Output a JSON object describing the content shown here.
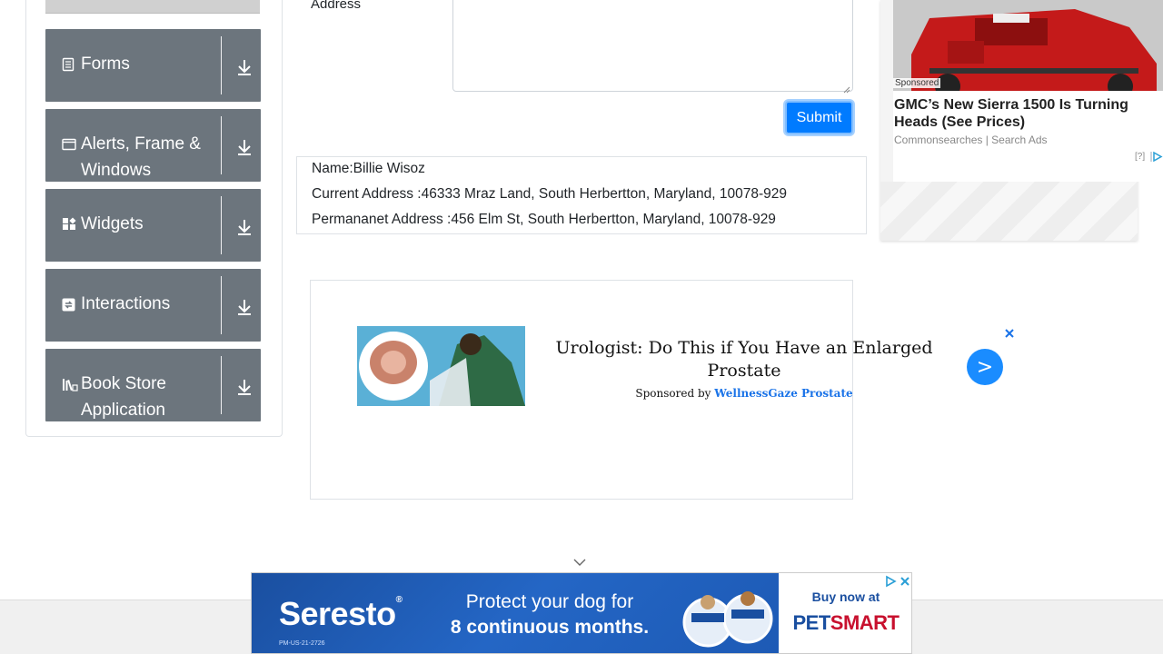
{
  "sidebar": {
    "groups": [
      {
        "label": "Forms",
        "icon": "document-icon"
      },
      {
        "label": "Alerts, Frame & Windows",
        "icon": "window-icon"
      },
      {
        "label": "Widgets",
        "icon": "widgets-icon"
      },
      {
        "label": "Interactions",
        "icon": "interactions-icon"
      },
      {
        "label": "Book Store Application",
        "icon": "books-icon"
      }
    ]
  },
  "form": {
    "address_label": "Address",
    "submit_label": "Submit"
  },
  "output": {
    "name": "Name:Billie Wisoz",
    "current_address": "Current Address :46333 Mraz Land, South Herbertton, Maryland, 10078-929",
    "permanent_address": "Permananet Address :456 Elm St, South Herbertton, Maryland, 10078-929"
  },
  "right_ad": {
    "sponsored": "Sponsored",
    "headline": "GMC’s New Sierra 1500 Is Turning Heads (See Prices)",
    "source": "Commonsearches | Search Ads",
    "help": "[?]"
  },
  "mid_ad": {
    "headline": "Urologist: Do This if You Have an Enlarged Prostate",
    "sponsor_prefix": "Sponsored by",
    "sponsor_brand": "WellnessGaze Prostate",
    "arrow": ">"
  },
  "banner": {
    "brand": "Seresto",
    "brand_mark": "®",
    "code": "PM-US-21-2726",
    "message_line1": "Protect your dog for",
    "message_line2": "8 continuous months.",
    "cta": "Buy now at",
    "store_pet": "PET",
    "store_smart": "SMART"
  },
  "colors": {
    "sidebar_group_bg": "#6c757d",
    "submit_bg": "#007bff",
    "banner_blue": "#1a4fa0",
    "petsmart_red": "#c8102e"
  }
}
